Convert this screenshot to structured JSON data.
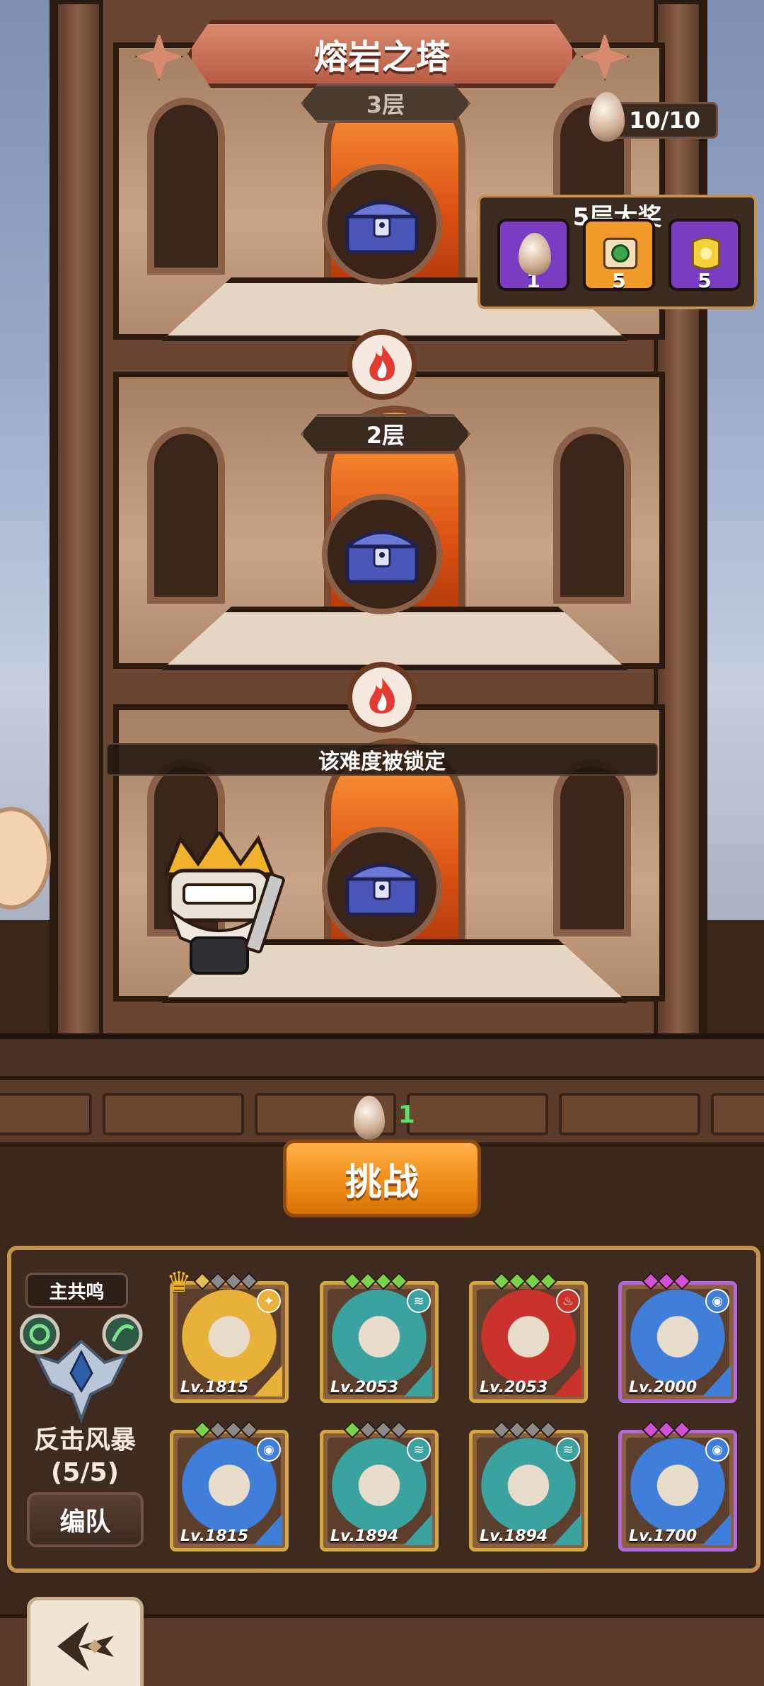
{
  "tower_title": "熔岩之塔",
  "keys": {
    "count": "10/10",
    "icon": "key-egg-icon"
  },
  "reward_panel": {
    "title": "5层大奖",
    "items": [
      {
        "icon": "egg-key-icon",
        "count": "1",
        "color": "#7b3cc4"
      },
      {
        "icon": "scroll-icon",
        "count": "5",
        "color": "#f09a2a"
      },
      {
        "icon": "gold-scroll-icon",
        "count": "5",
        "color": "#7b3cc4"
      }
    ]
  },
  "floors": [
    {
      "label": "3层",
      "chest_icon": "treasure-chest-icon"
    },
    {
      "label": "2层",
      "chest_icon": "treasure-chest-icon",
      "flame_icon": "fire-icon"
    },
    {
      "label": "",
      "chest_icon": "treasure-chest-icon",
      "flame_icon": "fire-icon"
    }
  ],
  "lock_notice": "该难度被锁定",
  "challenge": {
    "cost": "1",
    "label": "挑战"
  },
  "team": {
    "leader_tag": "主共鸣",
    "skill_name": "反击风暴",
    "skill_count": "(5/5)",
    "formation_label": "编队",
    "heroes": [
      {
        "level": "Lv.1815",
        "rarity": "gold",
        "element": "light",
        "stars": [
          "#e0c25a",
          "#8a8a8a",
          "#8a8a8a",
          "#8a8a8a"
        ],
        "color": "#e8b23a",
        "crown": true
      },
      {
        "level": "Lv.2053",
        "rarity": "gold",
        "element": "wind",
        "stars": [
          "#7bd34a",
          "#7bd34a",
          "#7bd34a",
          "#7bd34a"
        ],
        "color": "#3aa3a0"
      },
      {
        "level": "Lv.2053",
        "rarity": "gold",
        "element": "fire",
        "stars": [
          "#7bd34a",
          "#7bd34a",
          "#7bd34a",
          "#7bd34a"
        ],
        "color": "#c9332b"
      },
      {
        "level": "Lv.2000",
        "rarity": "purple",
        "element": "water",
        "stars": [
          "#d24fd8",
          "#d24fd8",
          "#d24fd8"
        ],
        "color": "#3f7fd9"
      },
      {
        "level": "Lv.1815",
        "rarity": "gold",
        "element": "water",
        "stars": [
          "#7bd34a",
          "#8a8a8a",
          "#8a8a8a",
          "#8a8a8a"
        ],
        "color": "#3f7fd9"
      },
      {
        "level": "Lv.1894",
        "rarity": "gold",
        "element": "wind",
        "stars": [
          "#7bd34a",
          "#8a8a8a",
          "#8a8a8a",
          "#8a8a8a"
        ],
        "color": "#3aa3a0"
      },
      {
        "level": "Lv.1894",
        "rarity": "gold",
        "element": "wind",
        "stars": [
          "#8a8a8a",
          "#8a8a8a",
          "#8a8a8a",
          "#8a8a8a"
        ],
        "color": "#3aa3a0"
      },
      {
        "level": "Lv.1700",
        "rarity": "purple",
        "element": "water",
        "stars": [
          "#d24fd8",
          "#d24fd8",
          "#d24fd8"
        ],
        "color": "#3f7fd9"
      }
    ]
  },
  "back_icon": "back-arrow-icon"
}
